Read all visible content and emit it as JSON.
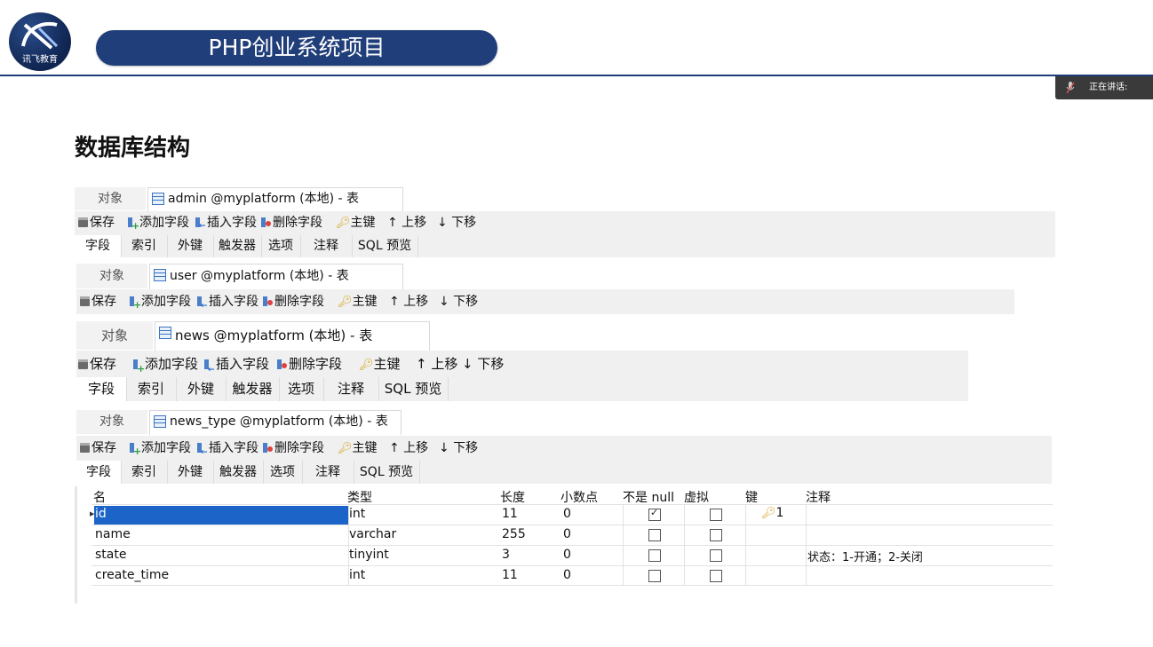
{
  "header": {
    "logo_text": "讯飞教育",
    "title": "PHP创业系统项目",
    "speaking_label": "正在讲话:"
  },
  "heading": "数据库结构",
  "toolbar": {
    "save": "保存",
    "add_field": "添加字段",
    "insert_field": "插入字段",
    "delete_field": "删除字段",
    "primary_key": "主键",
    "move_up": "↑ 上移",
    "move_down": "↓ 下移"
  },
  "objects_tab": "对象",
  "subtabs": [
    "字段",
    "索引",
    "外键",
    "触发器",
    "选项",
    "注释",
    "SQL 预览"
  ],
  "tables": [
    {
      "tab": "admin @myplatform (本地) - 表"
    },
    {
      "tab": "user @myplatform (本地) - 表"
    },
    {
      "tab": "news @myplatform (本地) - 表"
    },
    {
      "tab": "news_type @myplatform (本地) - 表"
    }
  ],
  "grid": {
    "columns": [
      "名",
      "类型",
      "长度",
      "小数点",
      "不是 null",
      "虚拟",
      "键",
      "注释"
    ],
    "rows": [
      {
        "name": "id",
        "type": "int",
        "length": "11",
        "decimals": "0",
        "not_null": true,
        "virtual": false,
        "key": "1",
        "comment": ""
      },
      {
        "name": "name",
        "type": "varchar",
        "length": "255",
        "decimals": "0",
        "not_null": false,
        "virtual": false,
        "key": "",
        "comment": ""
      },
      {
        "name": "state",
        "type": "tinyint",
        "length": "3",
        "decimals": "0",
        "not_null": false,
        "virtual": false,
        "key": "",
        "comment": "状态：1-开通；2-关闭"
      },
      {
        "name": "create_time",
        "type": "int",
        "length": "11",
        "decimals": "0",
        "not_null": false,
        "virtual": false,
        "key": "",
        "comment": ""
      }
    ]
  },
  "colors": {
    "brand_blue": "#203e79",
    "selection": "#1c64c8",
    "key_gold": "#d6a31d"
  }
}
